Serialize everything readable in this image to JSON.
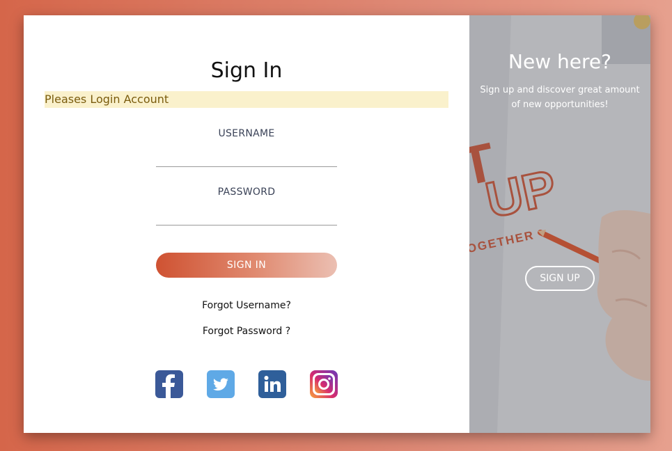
{
  "signin": {
    "title": "Sign In",
    "alert": "Pleases Login Account",
    "username_label": "USERNAME",
    "password_label": "PASSWORD",
    "signin_button": "SIGN IN",
    "forgot_username": "Forgot Username?",
    "forgot_password": "Forgot Password ?",
    "social": [
      {
        "name": "facebook-icon",
        "color": "#3b5998"
      },
      {
        "name": "twitter-icon",
        "color": "#5fa9e6"
      },
      {
        "name": "linkedin-icon",
        "color": "#2f5f9a"
      },
      {
        "name": "instagram-icon",
        "color": "#c13584"
      }
    ]
  },
  "signup": {
    "title": "New here?",
    "subtitle": "Sign up and discover great amount of new opportunities!",
    "signup_button": "SIGN UP",
    "image_text": [
      "T",
      "UP",
      "OGETHER"
    ]
  },
  "colors": {
    "accent": "#cf5232",
    "alert_bg": "#faf1cc",
    "alert_text": "#7a5c0e"
  }
}
